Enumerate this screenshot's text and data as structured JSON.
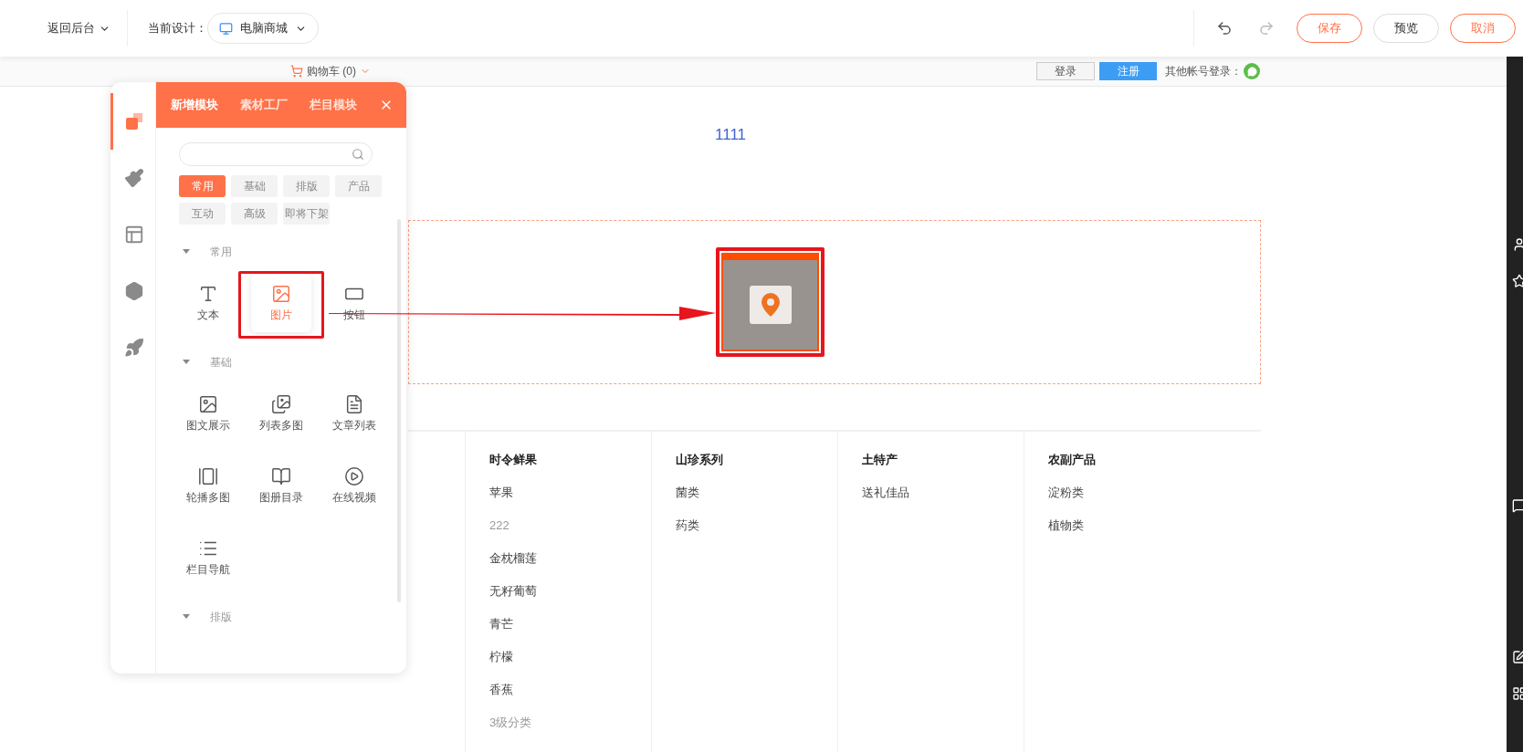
{
  "top_bar": {
    "back": "返回后台",
    "design_label": "当前设计：",
    "design_select": "电脑商城",
    "buttons": [
      {
        "label": "保存",
        "kind": "accent"
      },
      {
        "label": "预览",
        "kind": "plain"
      },
      {
        "label": "取消",
        "kind": "accent"
      }
    ]
  },
  "site_header": {
    "cart": "购物车 (0)",
    "login": "登录",
    "register": "注册",
    "other_login": "其他帐号登录："
  },
  "panel": {
    "rail": [
      {
        "kind": "modules",
        "selected": true
      },
      {
        "kind": "brush",
        "selected": false
      },
      {
        "kind": "layout",
        "selected": false
      },
      {
        "kind": "hexagon",
        "selected": false
      },
      {
        "kind": "rocket",
        "selected": false
      }
    ],
    "tabs": [
      {
        "label": "新增模块",
        "selected": true
      },
      {
        "label": "素材工厂",
        "selected": false
      },
      {
        "label": "栏目模块",
        "selected": false
      }
    ],
    "filter_tags": [
      {
        "label": "常用",
        "selected": true
      },
      {
        "label": "基础",
        "selected": false
      },
      {
        "label": "排版",
        "selected": false
      },
      {
        "label": "产品",
        "selected": false
      },
      {
        "label": "互动",
        "selected": false
      },
      {
        "label": "高级",
        "selected": false
      },
      {
        "label": "即将下架",
        "selected": false
      }
    ],
    "sections": [
      {
        "title": "常用",
        "expanded": true,
        "items": [
          {
            "label": "文本",
            "kind": "text",
            "selected": false
          },
          {
            "label": "图片",
            "kind": "image",
            "selected": true
          },
          {
            "label": "按钮",
            "kind": "button",
            "selected": false
          }
        ]
      },
      {
        "title": "基础",
        "expanded": true,
        "items": [
          {
            "label": "图文展示",
            "kind": "image-text",
            "selected": false
          },
          {
            "label": "列表多图",
            "kind": "images",
            "selected": false
          },
          {
            "label": "文章列表",
            "kind": "article",
            "selected": false
          },
          {
            "label": "轮播多图",
            "kind": "carousel",
            "selected": false
          },
          {
            "label": "图册目录",
            "kind": "album",
            "selected": false
          },
          {
            "label": "在线视频",
            "kind": "video",
            "selected": false
          },
          {
            "label": "栏目导航",
            "kind": "nav",
            "selected": false
          }
        ]
      },
      {
        "title": "排版",
        "expanded": true
      }
    ]
  },
  "canvas": {
    "title": "1111",
    "image_block": {
      "selected": true
    }
  },
  "categories": [
    {
      "title": "时令鲜果",
      "items": [
        {
          "label": "苹果",
          "kind": "main"
        },
        {
          "label": "222",
          "kind": "sub"
        },
        {
          "label": "金枕榴莲",
          "kind": "main"
        },
        {
          "label": "无籽葡萄",
          "kind": "main"
        },
        {
          "label": "青芒",
          "kind": "main"
        },
        {
          "label": "柠檬",
          "kind": "main"
        },
        {
          "label": "香蕉",
          "kind": "main"
        },
        {
          "label": "3级分类",
          "kind": "sub"
        }
      ]
    },
    {
      "title": "山珍系列",
      "items": [
        {
          "label": "菌类",
          "kind": "main"
        },
        {
          "label": "药类",
          "kind": "main"
        }
      ]
    },
    {
      "title": "土特产",
      "items": [
        {
          "label": "送礼佳品",
          "kind": "main"
        }
      ]
    },
    {
      "title": "农副产品",
      "items": [
        {
          "label": "淀粉类",
          "kind": "main"
        },
        {
          "label": "植物类",
          "kind": "main"
        }
      ]
    }
  ]
}
